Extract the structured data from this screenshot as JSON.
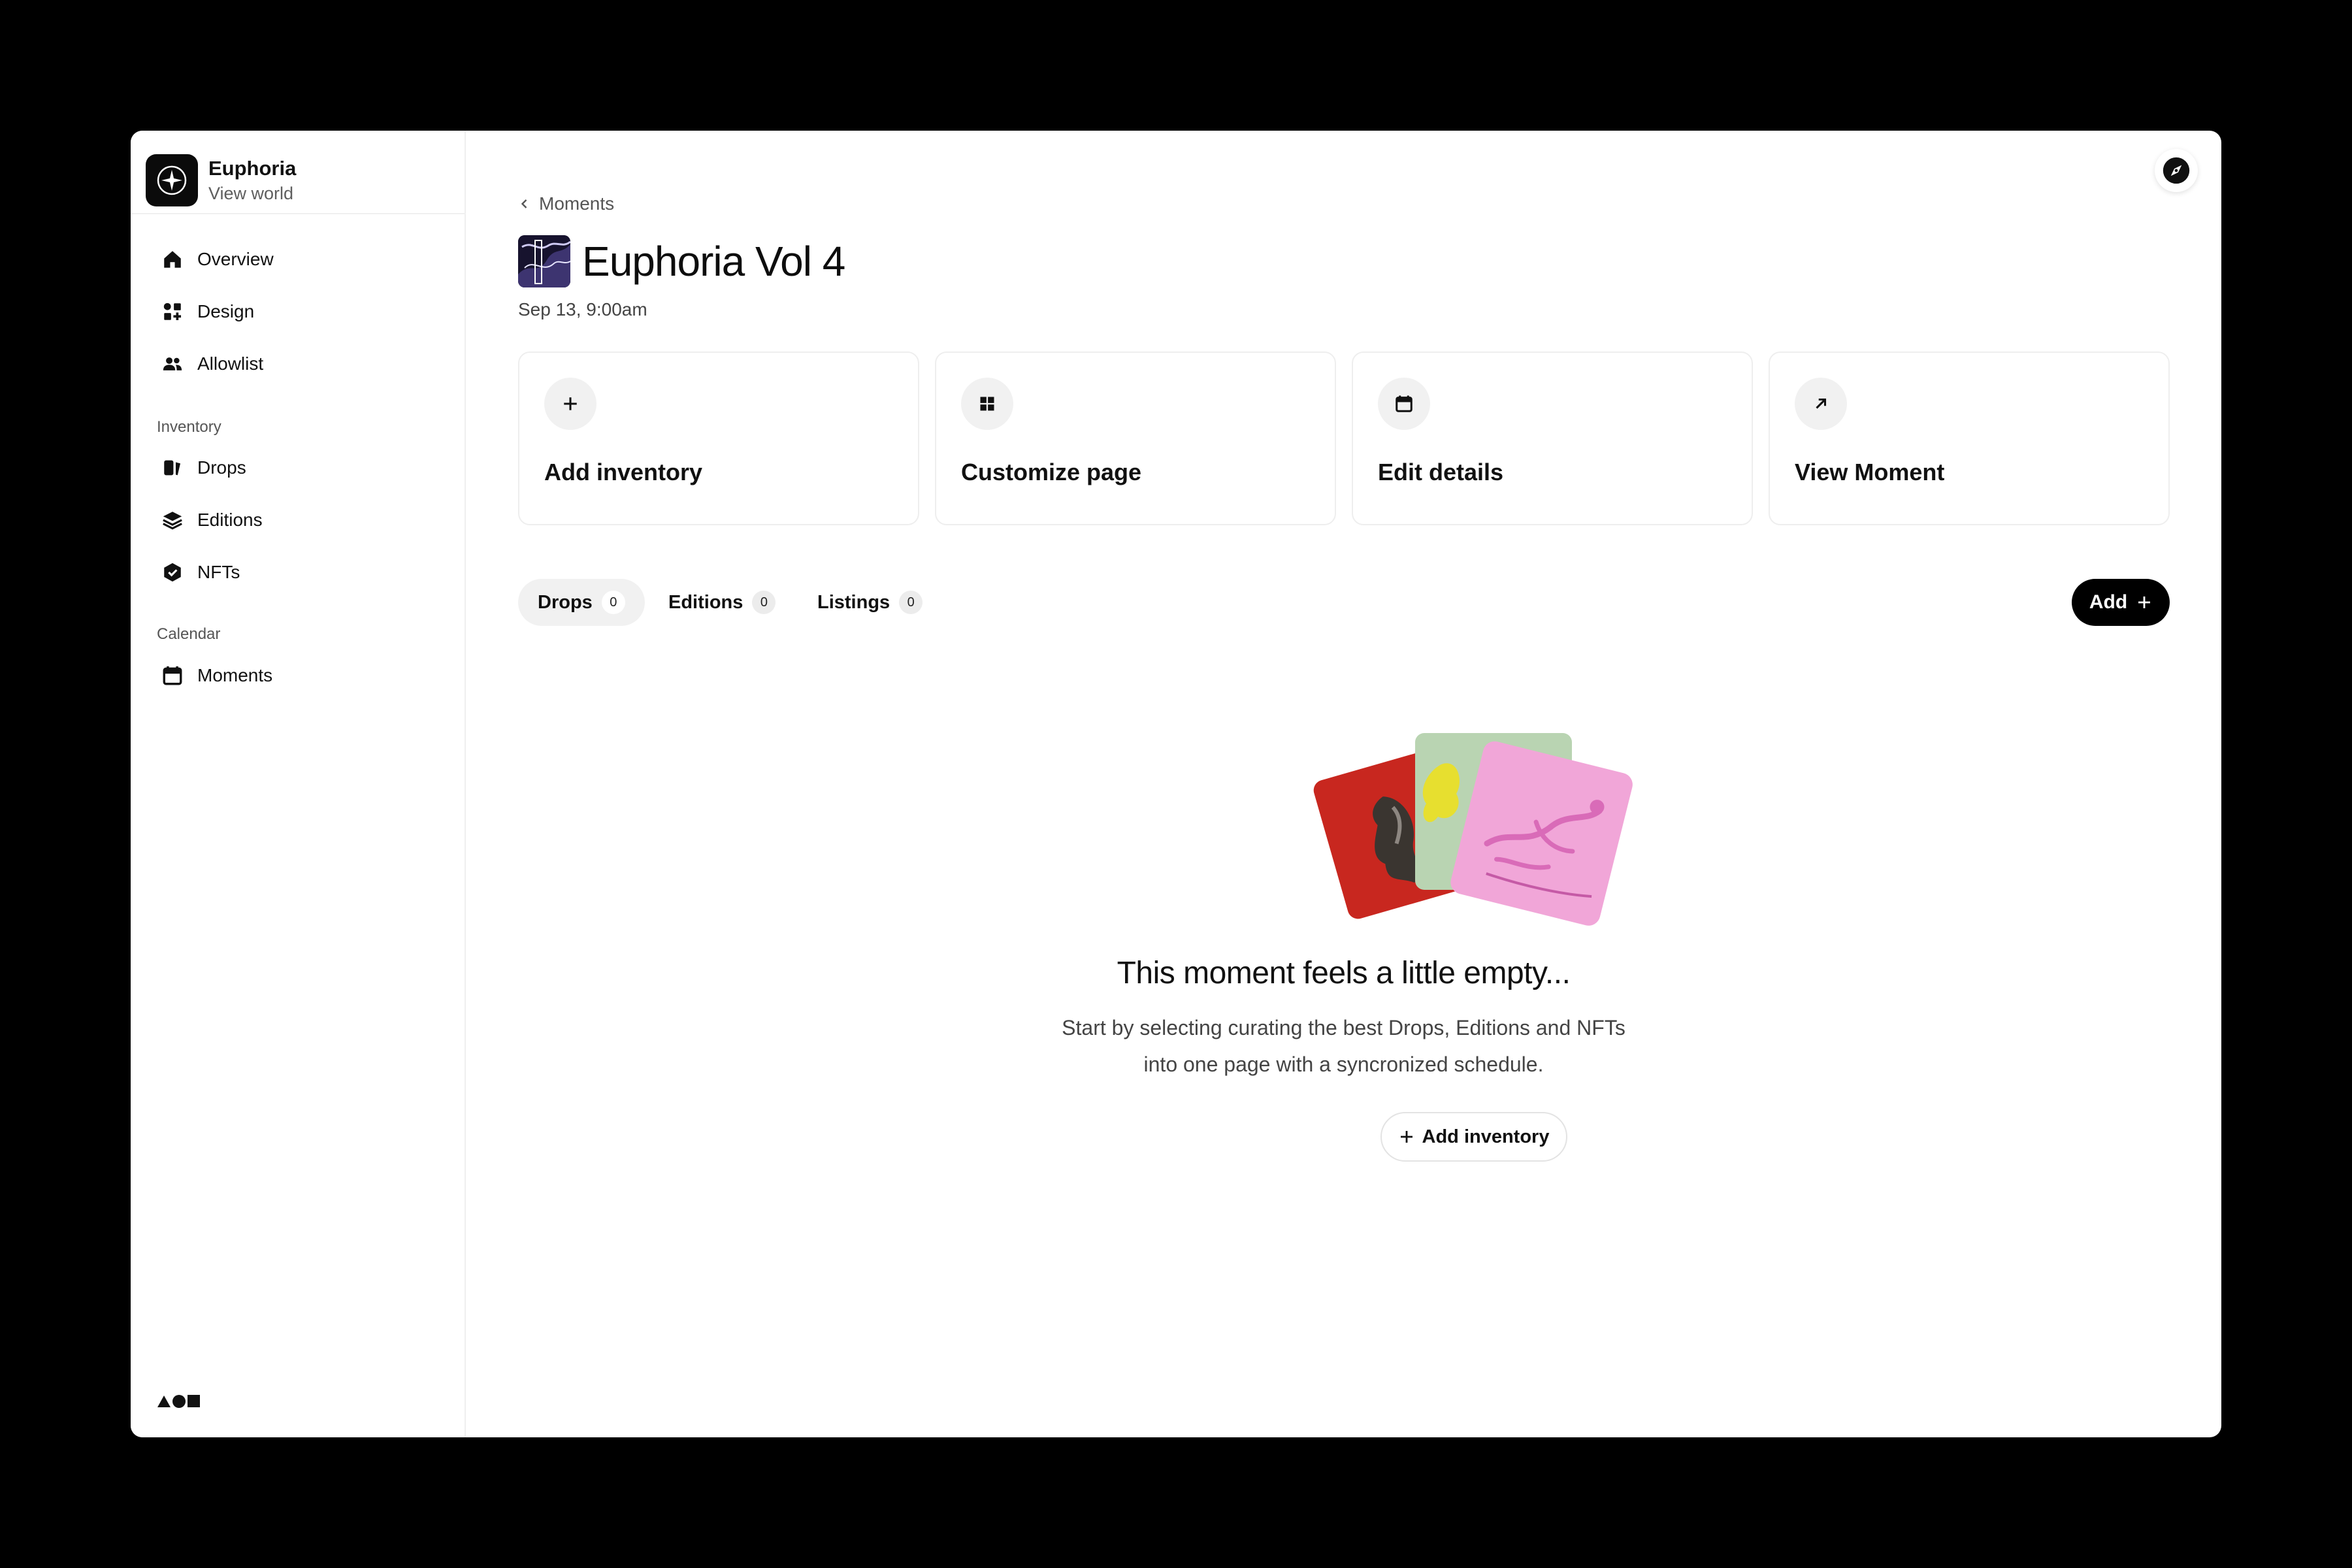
{
  "app": {
    "name": "Euphoria",
    "subtitle": "View world"
  },
  "sidebar": {
    "items": [
      {
        "label": "Overview",
        "icon": "home-icon"
      },
      {
        "label": "Design",
        "icon": "design-icon"
      },
      {
        "label": "Allowlist",
        "icon": "users-icon"
      }
    ],
    "sections": [
      {
        "label": "Inventory",
        "items": [
          {
            "label": "Drops",
            "icon": "drops-icon"
          },
          {
            "label": "Editions",
            "icon": "layers-icon"
          },
          {
            "label": "NFTs",
            "icon": "shield-check-icon"
          }
        ]
      },
      {
        "label": "Calendar",
        "items": [
          {
            "label": "Moments",
            "icon": "calendar-icon"
          }
        ]
      }
    ]
  },
  "header": {
    "breadcrumb": "Moments",
    "title": "Euphoria Vol 4",
    "date": "Sep 13, 9:00am"
  },
  "actions": [
    {
      "label": "Add inventory",
      "icon": "plus-icon"
    },
    {
      "label": "Customize page",
      "icon": "grid-icon"
    },
    {
      "label": "Edit details",
      "icon": "calendar-icon"
    },
    {
      "label": "View Moment",
      "icon": "arrow-up-right-icon"
    }
  ],
  "tabs": [
    {
      "label": "Drops",
      "count": "0",
      "active": true
    },
    {
      "label": "Editions",
      "count": "0",
      "active": false
    },
    {
      "label": "Listings",
      "count": "0",
      "active": false
    }
  ],
  "toolbar": {
    "add_label": "Add"
  },
  "empty_state": {
    "title": "This moment feels a little empty...",
    "line1": "Start by selecting curating the best Drops, Editions and NFTs",
    "line2": "into one page with a syncronized schedule.",
    "button_label": "Add inventory"
  },
  "colors": {
    "accent": "#000000",
    "card_red": "#c8271f",
    "card_green": "#b9d4b2",
    "card_pink": "#f1a6d8"
  }
}
